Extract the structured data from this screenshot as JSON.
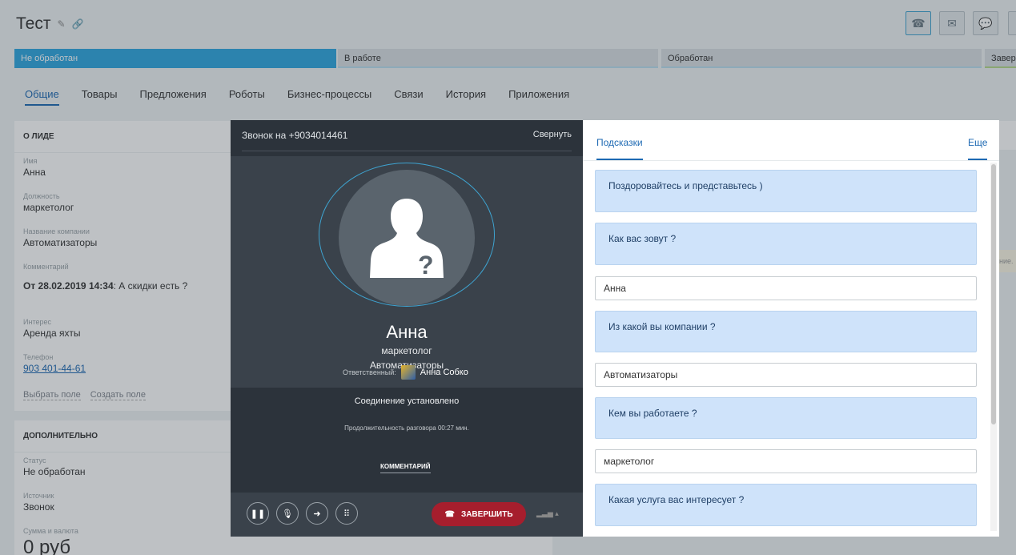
{
  "page": {
    "title": "Тест",
    "stages": [
      "Не обработан",
      "В работе",
      "Обработан",
      "Завер"
    ],
    "tabs": [
      "Общие",
      "Товары",
      "Предложения",
      "Роботы",
      "Бизнес-процессы",
      "Связи",
      "История",
      "Приложения"
    ],
    "about": {
      "header": "О ЛИДЕ",
      "name_label": "Имя",
      "name": "Анна",
      "position_label": "Должность",
      "position": "маркетолог",
      "company_label": "Название компании",
      "company": "Автоматизаторы",
      "comment_label": "Комментарий",
      "comment_date": "От 28.02.2019 14:34",
      "comment_text": ": А скидки есть ?",
      "interest_label": "Интерес",
      "interest": "Аренда яхты",
      "phone_label": "Телефон",
      "phone": "903 401-44-61",
      "select_field": "Выбрать поле",
      "create_field": "Создать поле"
    },
    "extra": {
      "header": "ДОПОЛНИТЕЛЬНО",
      "status_label": "Статус",
      "status": "Не обработан",
      "source_label": "Источник",
      "source": "Звонок",
      "sum_label": "Сумма и валюта",
      "sum": "0 руб"
    },
    "right_stub_text": "ние."
  },
  "call": {
    "header": "Звонок на +9034014461",
    "collapse": "Свернуть",
    "contact_name": "Анна",
    "contact_position": "маркетолог",
    "contact_company": "Автоматизаторы",
    "responsible_label": "Ответственный:",
    "responsible_name": "Анна Собко",
    "status": "Соединение установлено",
    "duration": "Продолжительность разговора 00:27 мин.",
    "comment_button": "КОММЕНТАРИЙ",
    "end_button": "ЗАВЕРШИТЬ"
  },
  "hints": {
    "tab_hints": "Подсказки",
    "tab_more": "Еще",
    "items": [
      {
        "question": "Поздоровайтесь и представьтесь )"
      },
      {
        "question": "Как вас зовут ?",
        "answer": "Анна"
      },
      {
        "question": "Из какой вы компании ?",
        "answer": "Автоматизаторы"
      },
      {
        "question": "Кем вы работаете ?",
        "answer": "маркетолог"
      },
      {
        "question": "Какая услуга вас интересует ?"
      }
    ]
  },
  "colors": {
    "accent": "#2fa6e0",
    "end_call": "#a61e2d",
    "hint_bg": "#cfe3fa",
    "link": "#1d69b3"
  }
}
